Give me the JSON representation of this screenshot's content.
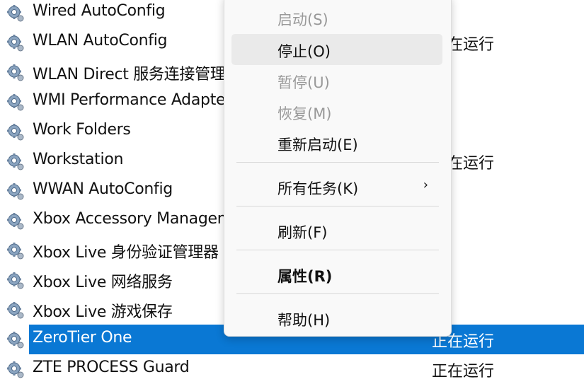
{
  "services": [
    {
      "name": "Wired AutoConfig",
      "status": ""
    },
    {
      "name": "WLAN AutoConfig",
      "status": "正在运行"
    },
    {
      "name": "WLAN Direct 服务连接管理器",
      "status": ""
    },
    {
      "name": "WMI Performance Adapter",
      "status": ""
    },
    {
      "name": "Work Folders",
      "status": ""
    },
    {
      "name": "Workstation",
      "status": "正在运行"
    },
    {
      "name": "WWAN AutoConfig",
      "status": ""
    },
    {
      "name": "Xbox Accessory Management Service",
      "status": ""
    },
    {
      "name": "Xbox Live 身份验证管理器",
      "status": ""
    },
    {
      "name": "Xbox Live 网络服务",
      "status": ""
    },
    {
      "name": "Xbox Live 游戏保存",
      "status": ""
    },
    {
      "name": "ZeroTier One",
      "status": "正在运行",
      "selected": true
    },
    {
      "name": "ZTE PROCESS Guard",
      "status": "正在运行"
    }
  ],
  "menu": {
    "start": "启动(S)",
    "stop": "停止(O)",
    "pause": "暂停(U)",
    "resume": "恢复(M)",
    "restart": "重新启动(E)",
    "all_tasks": "所有任务(K)",
    "refresh": "刷新(F)",
    "properties": "属性(R)",
    "help": "帮助(H)"
  },
  "colors": {
    "selection": "#0a78d4"
  }
}
